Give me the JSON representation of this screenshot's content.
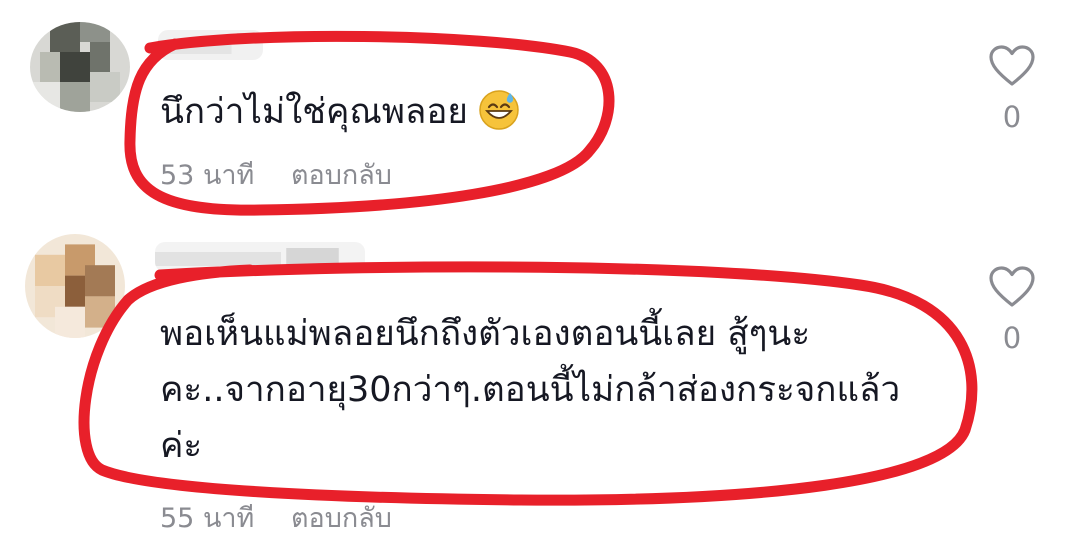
{
  "comments": [
    {
      "text": "นึกว่าไม่ใช่คุณพลอย",
      "emoji": "sweat-smile-emoji",
      "time": "53 นาที",
      "reply_label": "ตอบกลับ",
      "like_count": "0"
    },
    {
      "text_lines": [
        "พอเห็นแม่พลอยนึกถึงตัวเองตอนนี้เลย สู้ๆนะ",
        "คะ..จากอายุ30กว่าๆ.ตอนนี้ไม่กล้าส่องกระจกแล้ว",
        "ค่ะ"
      ],
      "time": "55 นาที",
      "reply_label": "ตอบกลับ",
      "like_count": "0"
    }
  ],
  "colors": {
    "text": "#161823",
    "meta": "#8a8b91",
    "annotation": "#e8202a",
    "heart_outline": "#8a8b91"
  }
}
